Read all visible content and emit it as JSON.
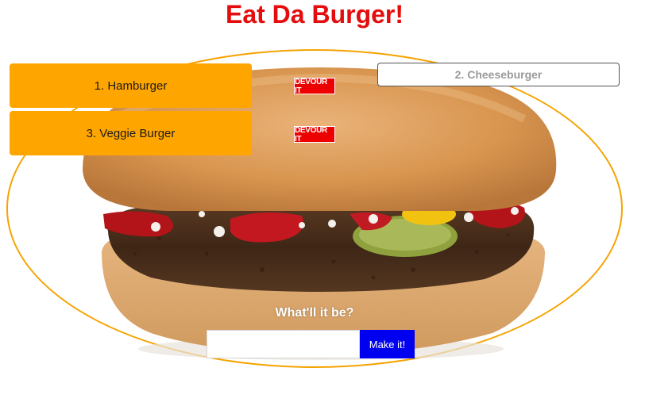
{
  "header": {
    "title": "Eat Da Burger!"
  },
  "burgers_to_eat": [
    {
      "label": "1. Hamburger",
      "devour_label": "DEVOUR IT"
    },
    {
      "label": "3. Veggie Burger",
      "devour_label": "DEVOUR IT"
    }
  ],
  "burgers_devoured": [
    {
      "label": "2. Cheeseburger"
    }
  ],
  "form": {
    "prompt": "What'll it be?",
    "input_value": "",
    "input_placeholder": "",
    "submit_label": "Make it!"
  },
  "colors": {
    "title": "#e40c0c",
    "oval_border": "#f5a300",
    "burger_button": "#ffa500",
    "devour_button": "#ee0000",
    "submit_button": "#0000f0"
  }
}
